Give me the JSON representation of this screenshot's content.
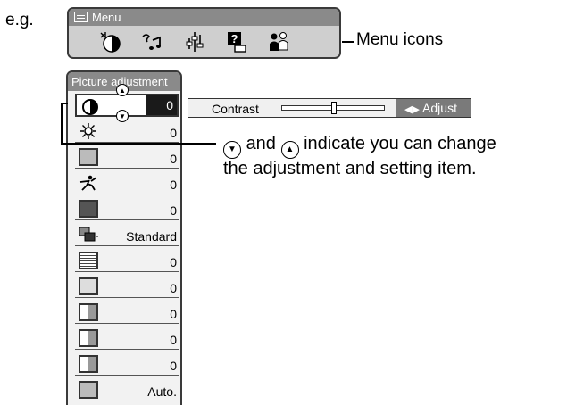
{
  "example_label": "e.g.",
  "menu": {
    "title": "Menu",
    "icons": [
      "picture-icon",
      "audio-icon",
      "setup-icon",
      "guide-icon",
      "language-icon"
    ],
    "callout": "Menu icons"
  },
  "picture_adjustment": {
    "title": "Picture adjustment",
    "items": [
      {
        "icon": "contrast-icon",
        "value": "0",
        "selected": true
      },
      {
        "icon": "brightness-icon",
        "value": "0"
      },
      {
        "icon": "color-icon",
        "value": "0"
      },
      {
        "icon": "sharpness-icon",
        "value": "0"
      },
      {
        "icon": "tint-icon",
        "value": "0"
      },
      {
        "icon": "progressive-icon",
        "value": "Standard"
      },
      {
        "icon": "red-icon",
        "value": "0"
      },
      {
        "icon": "green-icon",
        "value": "0"
      },
      {
        "icon": "blue-icon",
        "value": "0"
      },
      {
        "icon": "clock-icon",
        "value": "0"
      },
      {
        "icon": "phase-icon",
        "value": "0"
      },
      {
        "icon": "auto-icon",
        "value": "Auto."
      }
    ]
  },
  "contrast_bar": {
    "label": "Contrast",
    "level": 0.5,
    "adjust_label": "Adjust"
  },
  "note": {
    "part1": "and",
    "part2": "indicate you can change",
    "line2": "the adjustment and setting item."
  }
}
